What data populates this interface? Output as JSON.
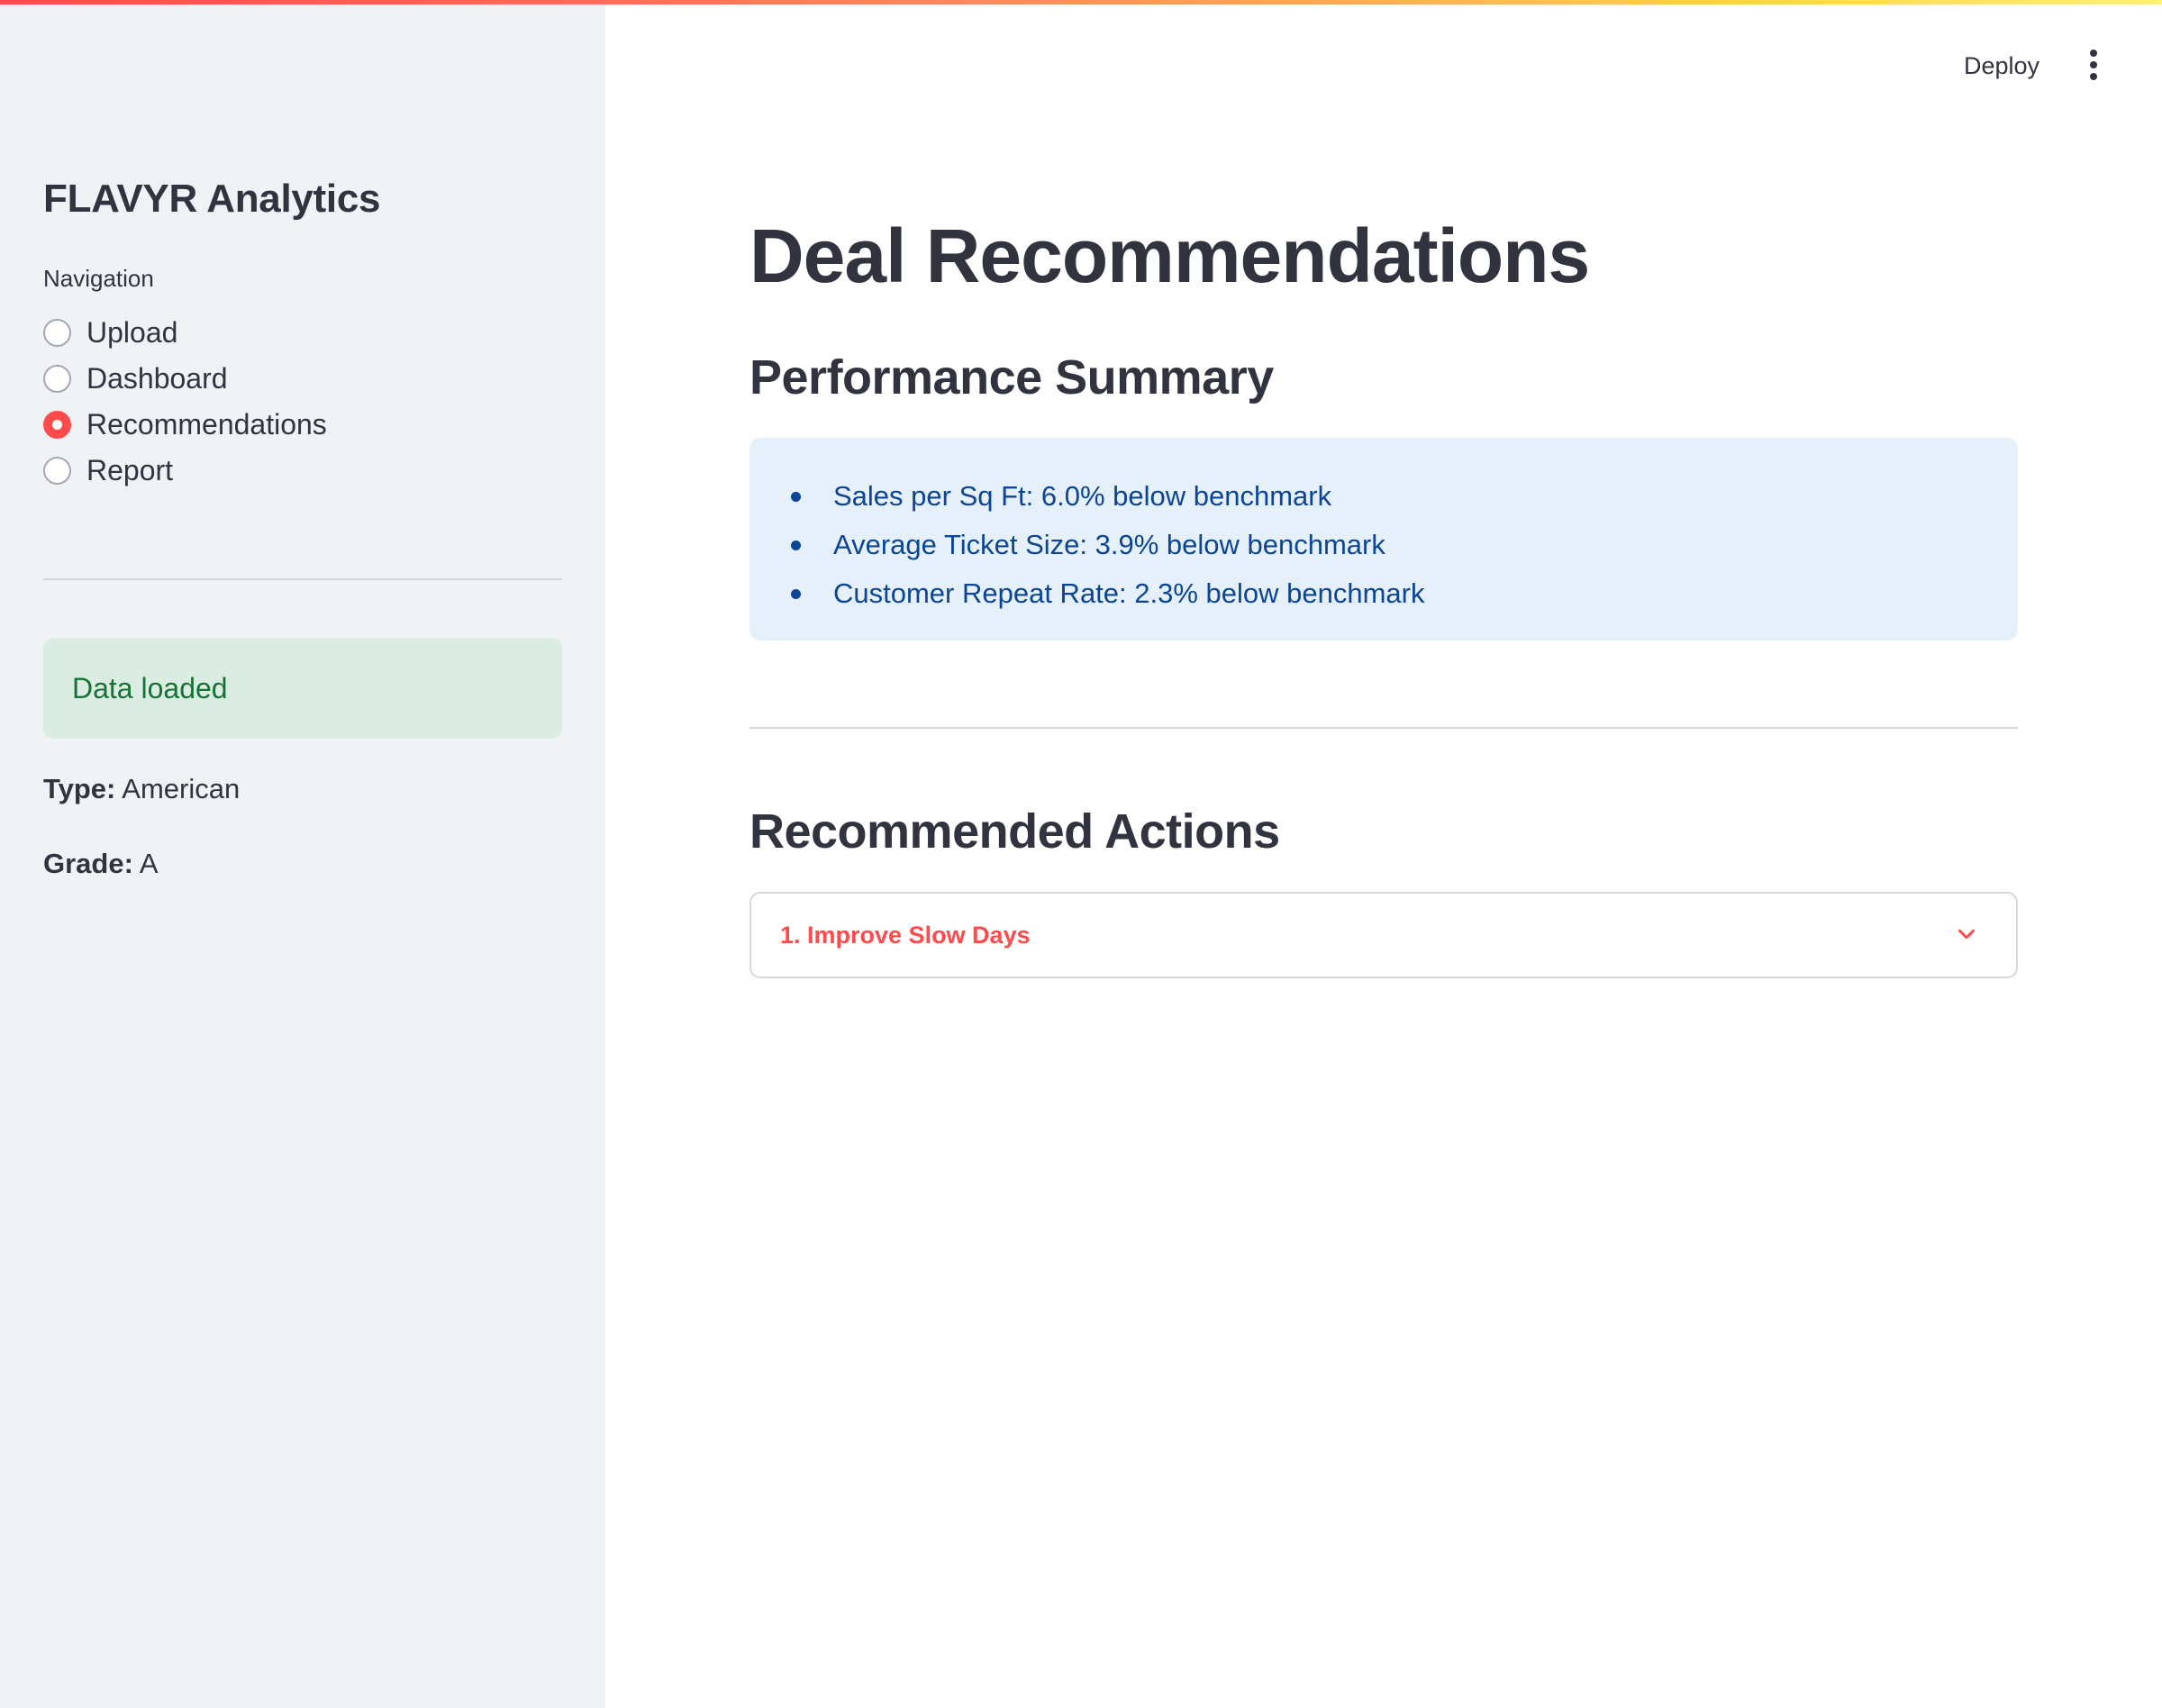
{
  "sidebar": {
    "title": "FLAVYR Analytics",
    "navigation_label": "Navigation",
    "nav_items": [
      {
        "label": "Upload",
        "selected": false
      },
      {
        "label": "Dashboard",
        "selected": false
      },
      {
        "label": "Recommendations",
        "selected": true
      },
      {
        "label": "Report",
        "selected": false
      }
    ],
    "status_alert": "Data loaded",
    "type_label": "Type:",
    "type_value": "American",
    "grade_label": "Grade:",
    "grade_value": "A"
  },
  "header": {
    "deploy_label": "Deploy",
    "menu_icon": "more-vertical-icon"
  },
  "main": {
    "title": "Deal Recommendations",
    "performance_heading": "Performance Summary",
    "performance_items": [
      "Sales per Sq Ft: 6.0% below benchmark",
      "Average Ticket Size: 3.9% below benchmark",
      "Customer Repeat Rate: 2.3% below benchmark"
    ],
    "actions_heading": "Recommended Actions",
    "actions": [
      {
        "label": "1. Improve Slow Days",
        "expanded": false
      }
    ]
  },
  "colors": {
    "accent": "#ff4b4b",
    "sidebar_bg": "#f0f2f6",
    "info_bg": "#e6f0fb",
    "info_text": "#0b4594",
    "success_bg": "#dbece2",
    "success_text": "#177233"
  }
}
